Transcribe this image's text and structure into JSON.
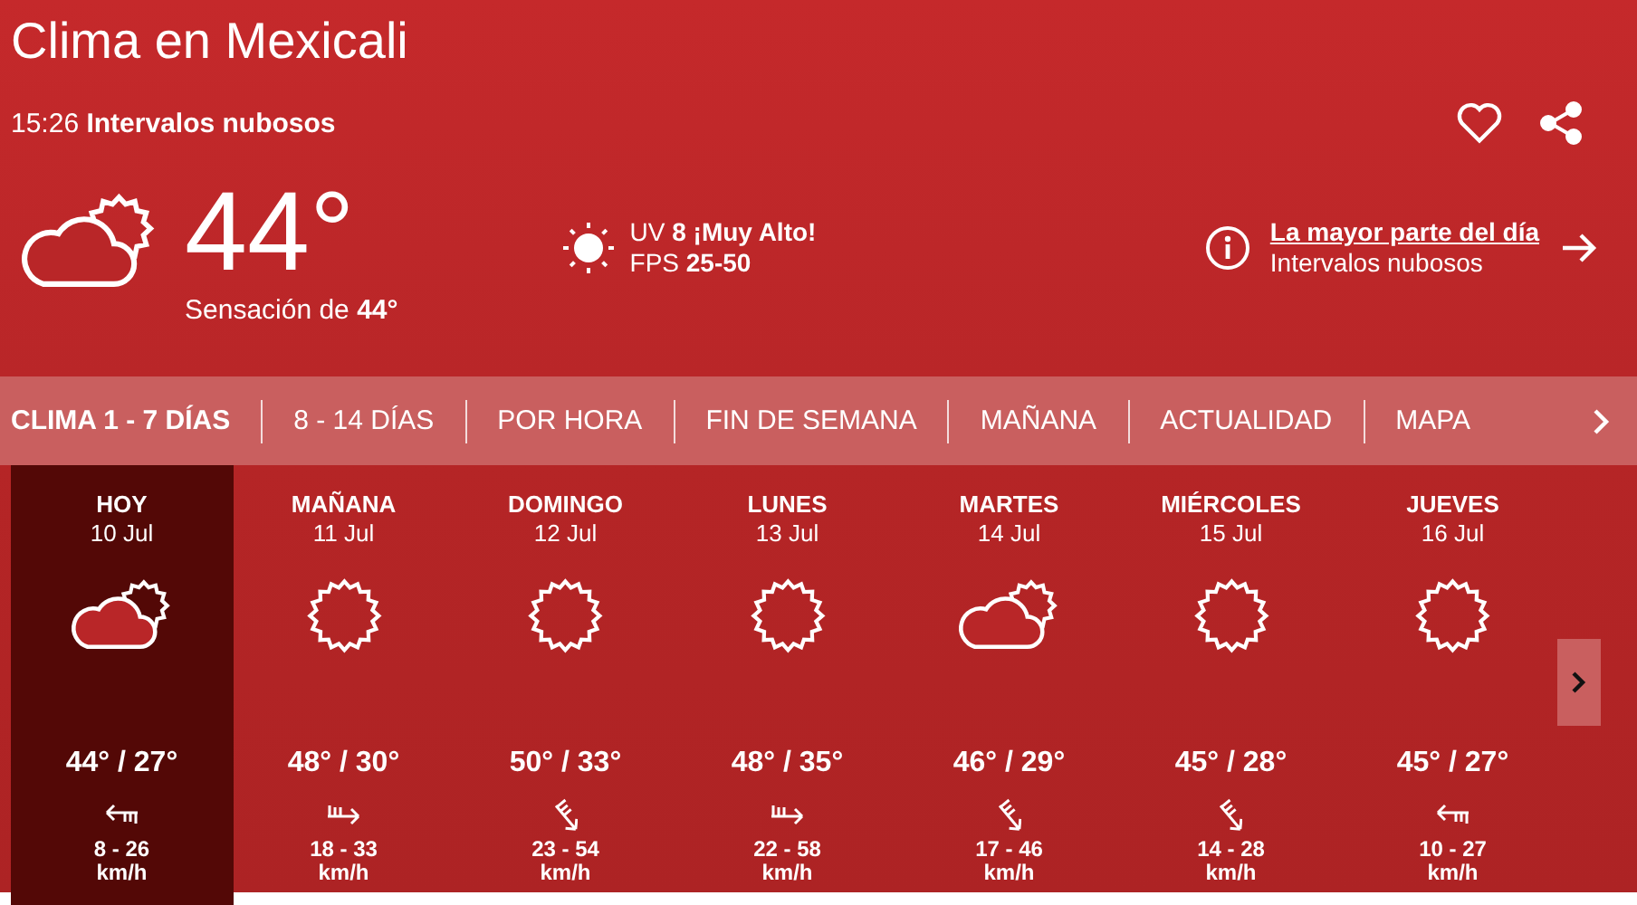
{
  "header": {
    "title": "Clima en Mexicali",
    "time": "15:26",
    "condition": "Intervalos nubosos"
  },
  "current": {
    "kind": "cloudy-sun",
    "temperature": "44°",
    "feels_label": "Sensación de",
    "feels_value": "44°",
    "uv_label": "UV",
    "uv_value": "8 ¡Muy Alto!",
    "fps_label": "FPS",
    "fps_value": "25-50",
    "summary_link": "La mayor parte del día",
    "summary": "Intervalos nubosos"
  },
  "tabs": [
    {
      "label": "CLIMA 1 - 7 DÍAS",
      "selected": true
    },
    {
      "label": "8 - 14 DÍAS",
      "selected": false
    },
    {
      "label": "POR HORA",
      "selected": false
    },
    {
      "label": "FIN DE SEMANA",
      "selected": false
    },
    {
      "label": "MAÑANA",
      "selected": false
    },
    {
      "label": "ACTUALIDAD",
      "selected": false
    },
    {
      "label": "MAPA",
      "selected": false
    }
  ],
  "days": [
    {
      "name": "HOY",
      "date": "10 Jul",
      "kind": "cloudy-sun",
      "temps": "44° / 27°",
      "wind": {
        "kind": "west",
        "speed": "8 - 26",
        "unit": "km/h"
      },
      "selected": true
    },
    {
      "name": "MAÑANA",
      "date": "11 Jul",
      "kind": "sun",
      "temps": "48° / 30°",
      "wind": {
        "kind": "east",
        "speed": "18 - 33",
        "unit": "km/h"
      },
      "selected": false
    },
    {
      "name": "DOMINGO",
      "date": "12 Jul",
      "kind": "sun",
      "temps": "50° / 33°",
      "wind": {
        "kind": "southeast",
        "speed": "23 - 54",
        "unit": "km/h"
      },
      "selected": false
    },
    {
      "name": "LUNES",
      "date": "13 Jul",
      "kind": "sun",
      "temps": "48° / 35°",
      "wind": {
        "kind": "east",
        "speed": "22 - 58",
        "unit": "km/h"
      },
      "selected": false
    },
    {
      "name": "MARTES",
      "date": "14 Jul",
      "kind": "cloudy-sun",
      "temps": "46° / 29°",
      "wind": {
        "kind": "southeast",
        "speed": "17 - 46",
        "unit": "km/h"
      },
      "selected": false
    },
    {
      "name": "MIÉRCOLES",
      "date": "15 Jul",
      "kind": "sun",
      "temps": "45° / 28°",
      "wind": {
        "kind": "southeast",
        "speed": "14 - 28",
        "unit": "km/h"
      },
      "selected": false
    },
    {
      "name": "JUEVES",
      "date": "16 Jul",
      "kind": "sun",
      "temps": "45° / 27°",
      "wind": {
        "kind": "west",
        "speed": "10 - 27",
        "unit": "km/h"
      },
      "selected": false
    }
  ]
}
